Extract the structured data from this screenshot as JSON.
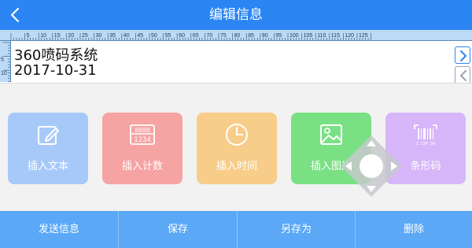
{
  "header": {
    "title": "编辑信息",
    "back_icon": "chevron-left-icon",
    "color": "#2b85f3"
  },
  "ruler": {
    "h_labels": [
      "5",
      "10",
      "15",
      "20",
      "25",
      "30",
      "35",
      "40",
      "45",
      "50",
      "55",
      "60",
      "65",
      "70",
      "75",
      "80",
      "85",
      "90",
      "95",
      "100",
      "105",
      "110",
      "115",
      "120",
      "125"
    ],
    "v_labels": [
      "5",
      "10"
    ]
  },
  "editor": {
    "line1": "360喷码系统",
    "line2": "2017-10-31",
    "next_icon": "chevron-right-icon",
    "prev_icon": "chevron-left-icon"
  },
  "tools": [
    {
      "label": "插入文本",
      "icon": "edit-icon",
      "color": "#a6c9f9"
    },
    {
      "label": "插入计数",
      "icon": "counter-icon",
      "color": "#f6a3a3",
      "icon_text_top": "0000",
      "icon_text_bottom": "1234"
    },
    {
      "label": "插入时间",
      "icon": "clock-icon",
      "color": "#f8cd8a"
    },
    {
      "label": "插入图片",
      "icon": "image-icon",
      "color": "#79e183"
    },
    {
      "label": "条形码",
      "icon": "barcode-icon",
      "color": "#d6b6f8",
      "icon_text": "1 234 56"
    }
  ],
  "bottom": {
    "send": "发送信息",
    "save": "保存",
    "save_as": "另存为",
    "delete": "删除",
    "color": "#5aa8f6"
  }
}
